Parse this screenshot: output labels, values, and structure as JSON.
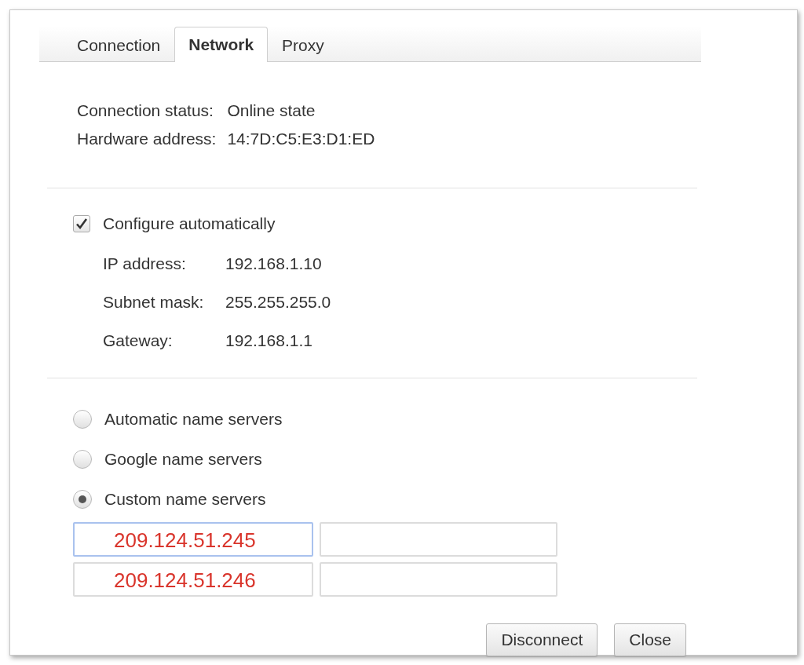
{
  "tabs": [
    {
      "label": "Connection",
      "selected": false
    },
    {
      "label": "Network",
      "selected": true
    },
    {
      "label": "Proxy",
      "selected": false
    }
  ],
  "info": [
    {
      "label": "Connection status:",
      "value": "Online state"
    },
    {
      "label": "Hardware address:",
      "value": "14:7D:C5:E3:D1:ED"
    }
  ],
  "configure_automatically": {
    "label": "Configure automatically",
    "checked": true
  },
  "ip_settings": [
    {
      "label": "IP address:",
      "value": "192.168.1.10"
    },
    {
      "label": "Subnet mask:",
      "value": "255.255.255.0"
    },
    {
      "label": "Gateway:",
      "value": "192.168.1.1"
    }
  ],
  "name_servers": [
    {
      "label": "Automatic name servers",
      "selected": false
    },
    {
      "label": "Google name servers",
      "selected": false
    },
    {
      "label": "Custom name servers",
      "selected": true
    }
  ],
  "custom_name_server_fields": [
    [
      {
        "value": "209.124.51.245",
        "focused": true
      },
      {
        "focused": false
      }
    ],
    [
      {
        "value": "209.124.51.246",
        "focused": false
      },
      {
        "focused": false
      }
    ]
  ],
  "buttons": [
    "Disconnect",
    "Close"
  ]
}
